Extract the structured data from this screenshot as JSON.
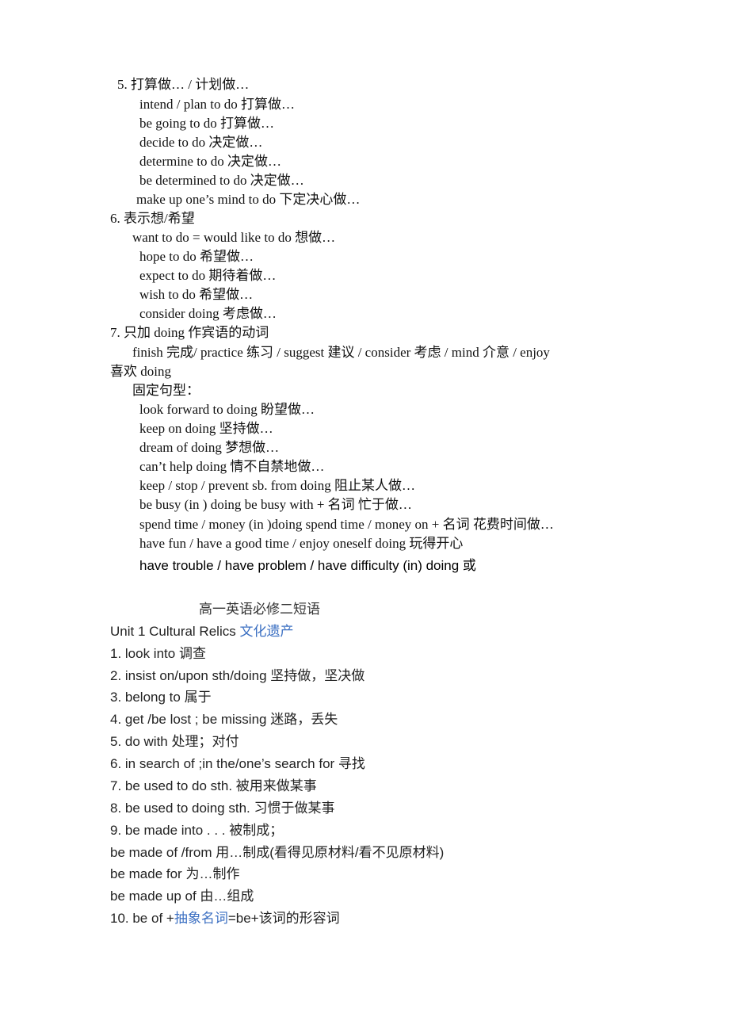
{
  "section5": {
    "heading": "5.  打算做…  /  计划做…",
    "items": [
      "intend / plan to do  打算做…",
      "be going to do  打算做…",
      "decide to do  决定做…",
      "determine to do 决定做…",
      "be determined to do 决定做…",
      "make up one’s mind to do  下定决心做…"
    ]
  },
  "section6": {
    "heading": "6.  表示想/希望",
    "items": [
      "want to do = would like to do  想做…",
      "hope to do  希望做…",
      "expect to do  期待着做…",
      "wish to do  希望做…",
      "consider doing  考虑做…"
    ]
  },
  "section7": {
    "heading": "7.  只加 doing  作宾语的动词",
    "verbs_line1": "finish  完成/ practice  练习  / suggest 建议  / consider  考虑  / mind  介意  / enjoy",
    "verbs_line2": "喜欢 doing",
    "fixed_label": "固定句型：",
    "items": [
      "look forward to doing  盼望做…",
      "keep on doing  坚持做…",
      "dream of doing  梦想做…",
      "can’t help doing  情不自禁地做…",
      "keep / stop / prevent sb. from doing  阻止某人做…",
      "be busy (in ) doing be busy with +  名词  忙于做…",
      "spend time / money (in )doing spend time / money on +  名词  花费时间做…",
      "have fun / have a good time / enjoy oneself doing  玩得开心"
    ],
    "last_item": "have trouble / have problem / have difficulty (in) doing  或"
  },
  "part2": {
    "title": "高一英语必修二短语",
    "unit_label": "Unit 1 Cultural Relics ",
    "unit_cn": "文化遗产",
    "items": [
      "1. look into  调查",
      "2. insist on/upon sth/doing  坚持做，坚决做",
      "3. belong to  属于",
      "4. get /be lost ; be missing  迷路，丢失",
      "5. do with  处理；对付",
      "6. in search of ;in the/one’s search for  寻找",
      "7. be used to do sth.  被用来做某事",
      "8. be used to doing sth.  习惯于做某事",
      "9. be made into . . .  被制成；",
      "be made of /from  用…制成(看得见原材料/看不见原材料)",
      "be made for  为…制作",
      "be made up of  由…组成"
    ],
    "item10": {
      "prefix": "10. be of +",
      "highlight": "抽象名词",
      "suffix": "=be+该词的形容词"
    },
    "highlight_color": "#3b6fc2"
  }
}
